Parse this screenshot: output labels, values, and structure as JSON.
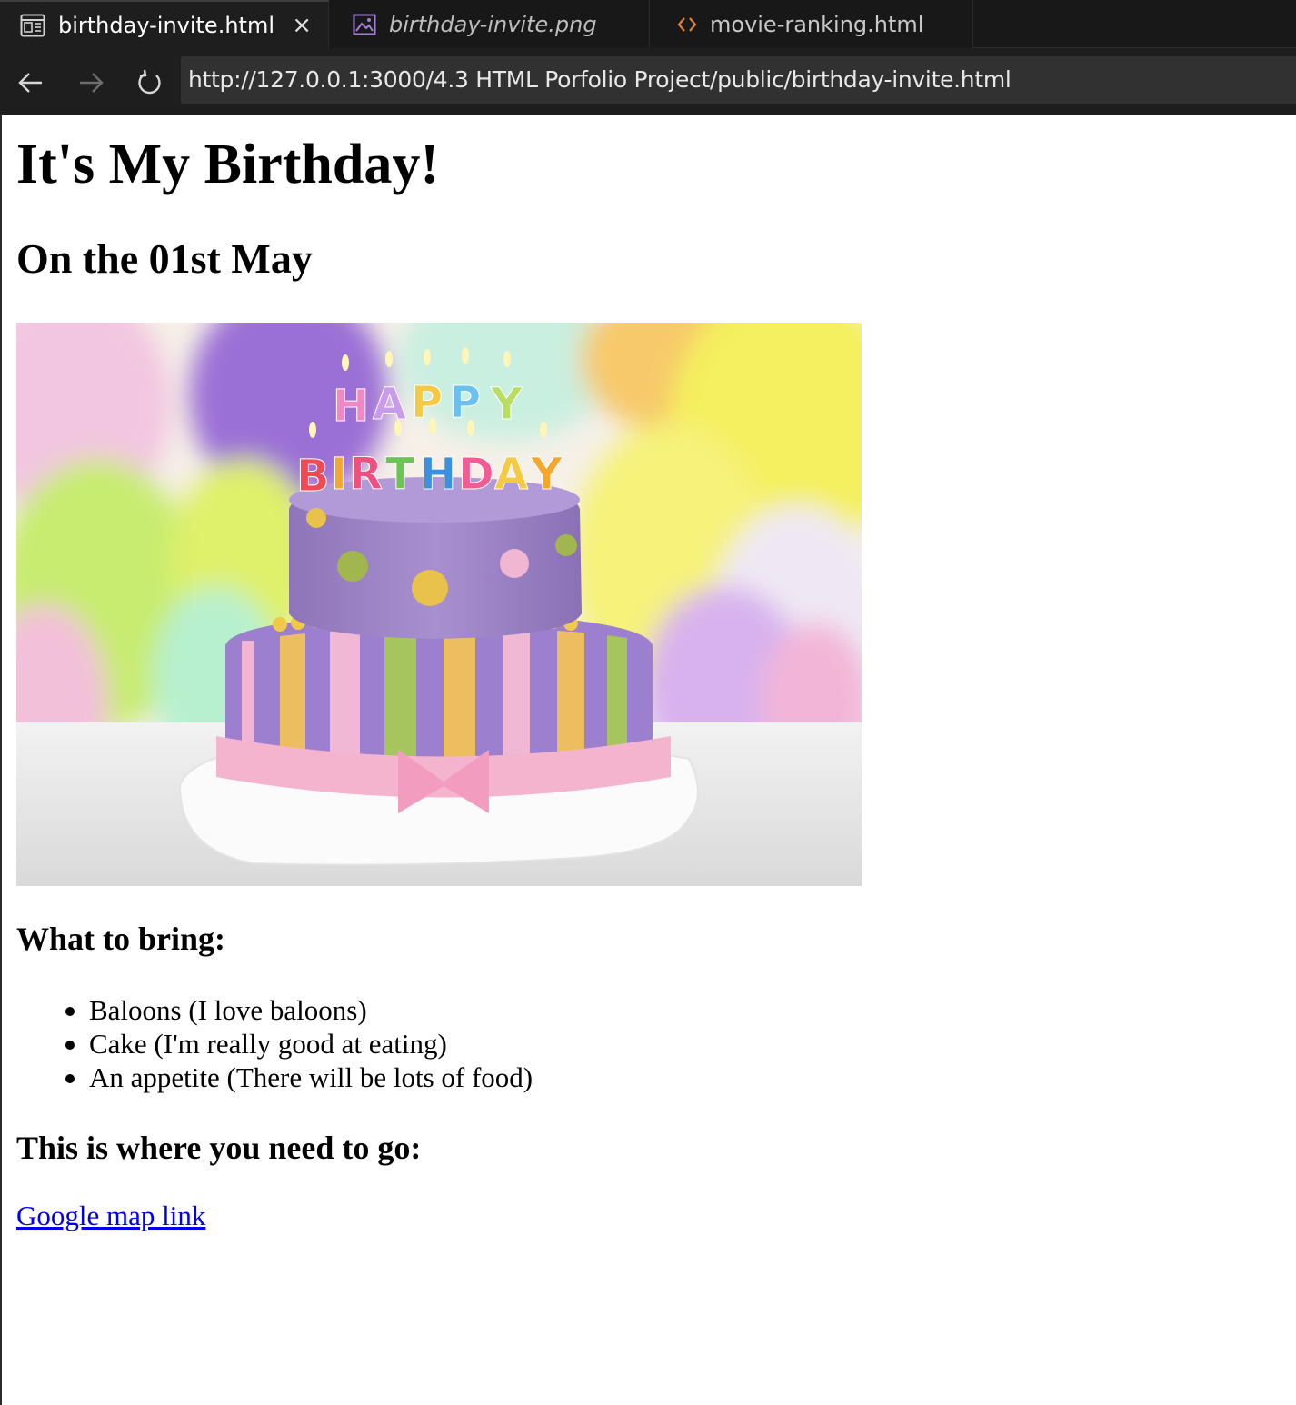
{
  "tabs": [
    {
      "label": "birthday-invite.html",
      "icon": "layout-preview-icon",
      "active": true,
      "closable": true
    },
    {
      "label": "birthday-invite.png",
      "icon": "image-file-icon",
      "active": false
    },
    {
      "label": "movie-ranking.html",
      "icon": "code-brackets-icon",
      "active": false
    }
  ],
  "tab_close_glyph": "×",
  "address": {
    "url": "http://127.0.0.1:3000/4.3 HTML Porfolio Project/public/birthday-invite.html"
  },
  "page": {
    "title": "It's My Birthday!",
    "subtitle": "On the 01st May",
    "image_icon": "birthday-cake-photo",
    "bring_heading": "What to bring:",
    "bring_items": [
      "Baloons (I love baloons)",
      "Cake (I'm really good at eating)",
      "An appetite (There will be lots of food)"
    ],
    "where_heading": "This is where you need to go:",
    "map_link": "Google map link"
  },
  "colors": {
    "chrome_bg": "#1e1e1e",
    "url_bg": "#313131",
    "link": "#0000ee",
    "image_tab_icon": "#a27fd3",
    "code_tab_icon": "#e0823c"
  }
}
